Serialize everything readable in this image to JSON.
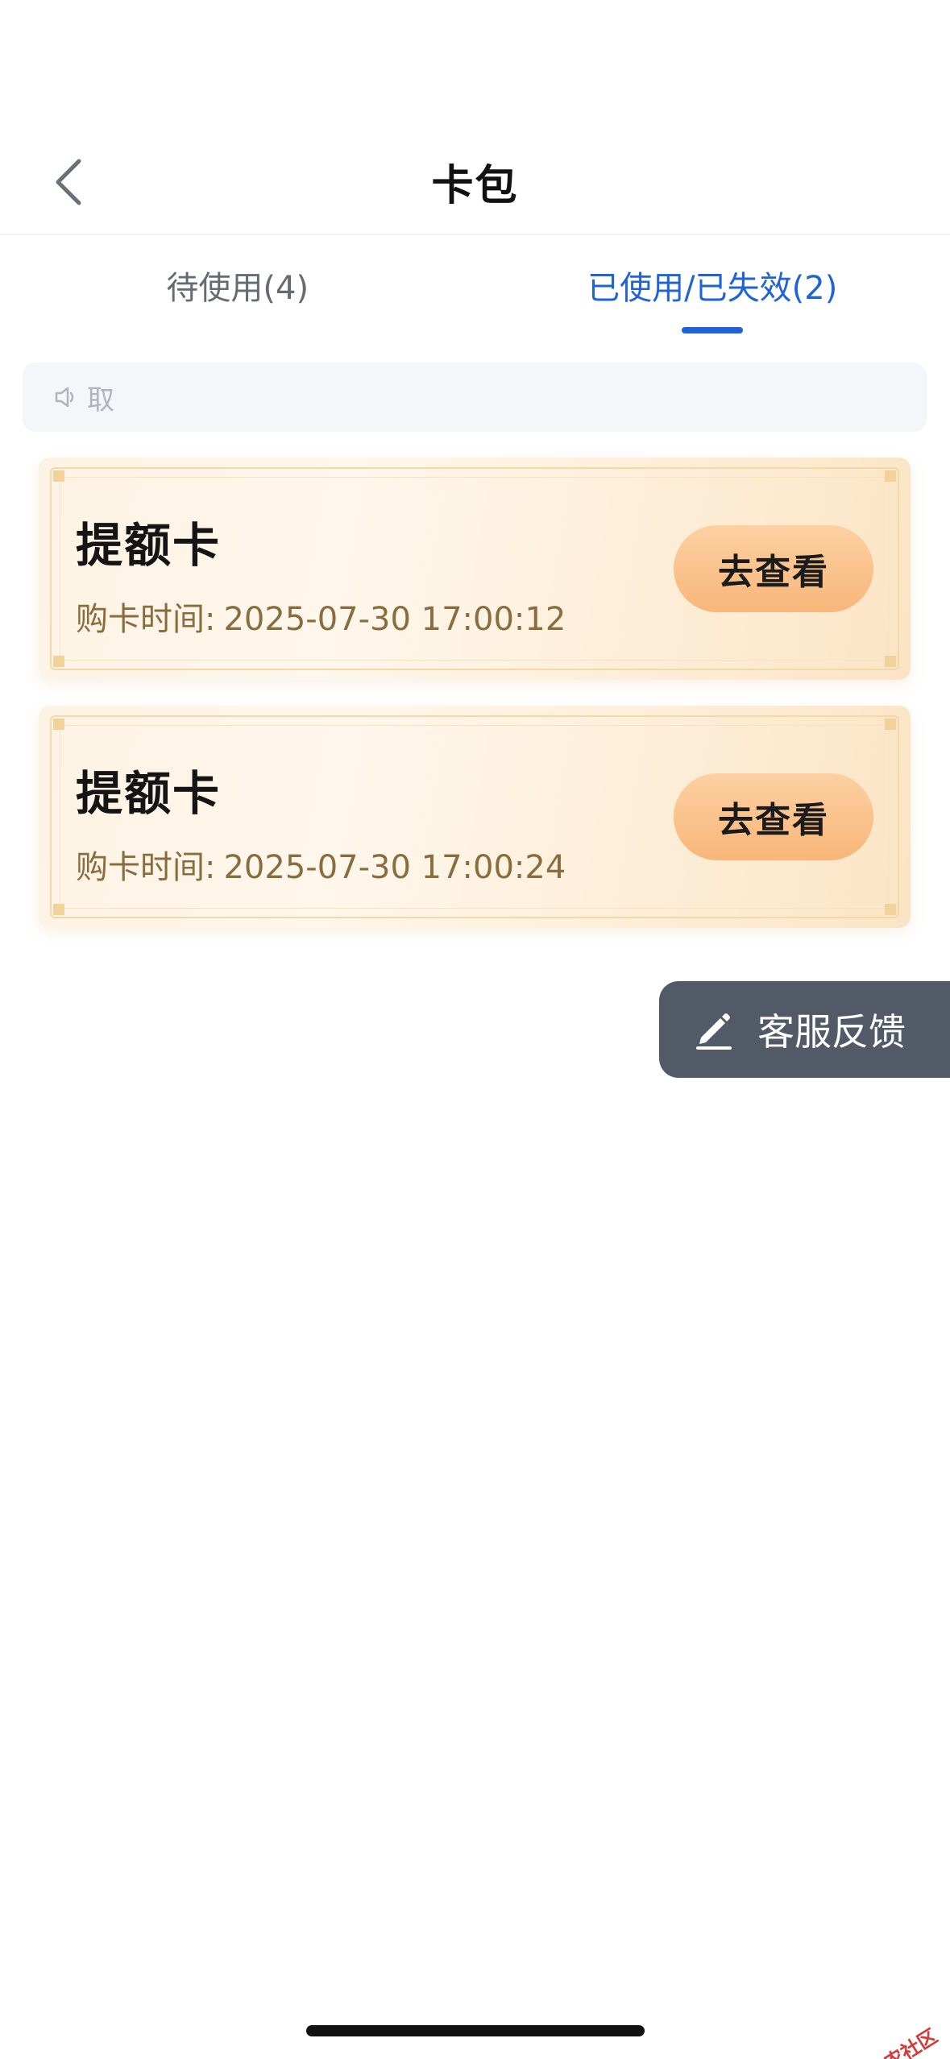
{
  "header": {
    "title": "卡包"
  },
  "tabs": [
    {
      "label": "待使用(4)",
      "active": false
    },
    {
      "label": "已使用/已失效(2)",
      "active": true
    }
  ],
  "notice": {
    "text": "取"
  },
  "cards": [
    {
      "title": "提额卡",
      "time_label": "购卡时间:",
      "time_value": "2025-07-30 17:00:12",
      "button_label": "去查看"
    },
    {
      "title": "提额卡",
      "time_label": "购卡时间:",
      "time_value": "2025-07-30 17:00:24",
      "button_label": "去查看"
    }
  ],
  "feedback": {
    "label": "客服反馈"
  },
  "watermark": {
    "text": "卡农社区"
  },
  "colors": {
    "accent": "#1f63d6",
    "card_button": "#f8b67a",
    "feedback_bg": "#515a66",
    "time_text": "#8a6d3f"
  }
}
